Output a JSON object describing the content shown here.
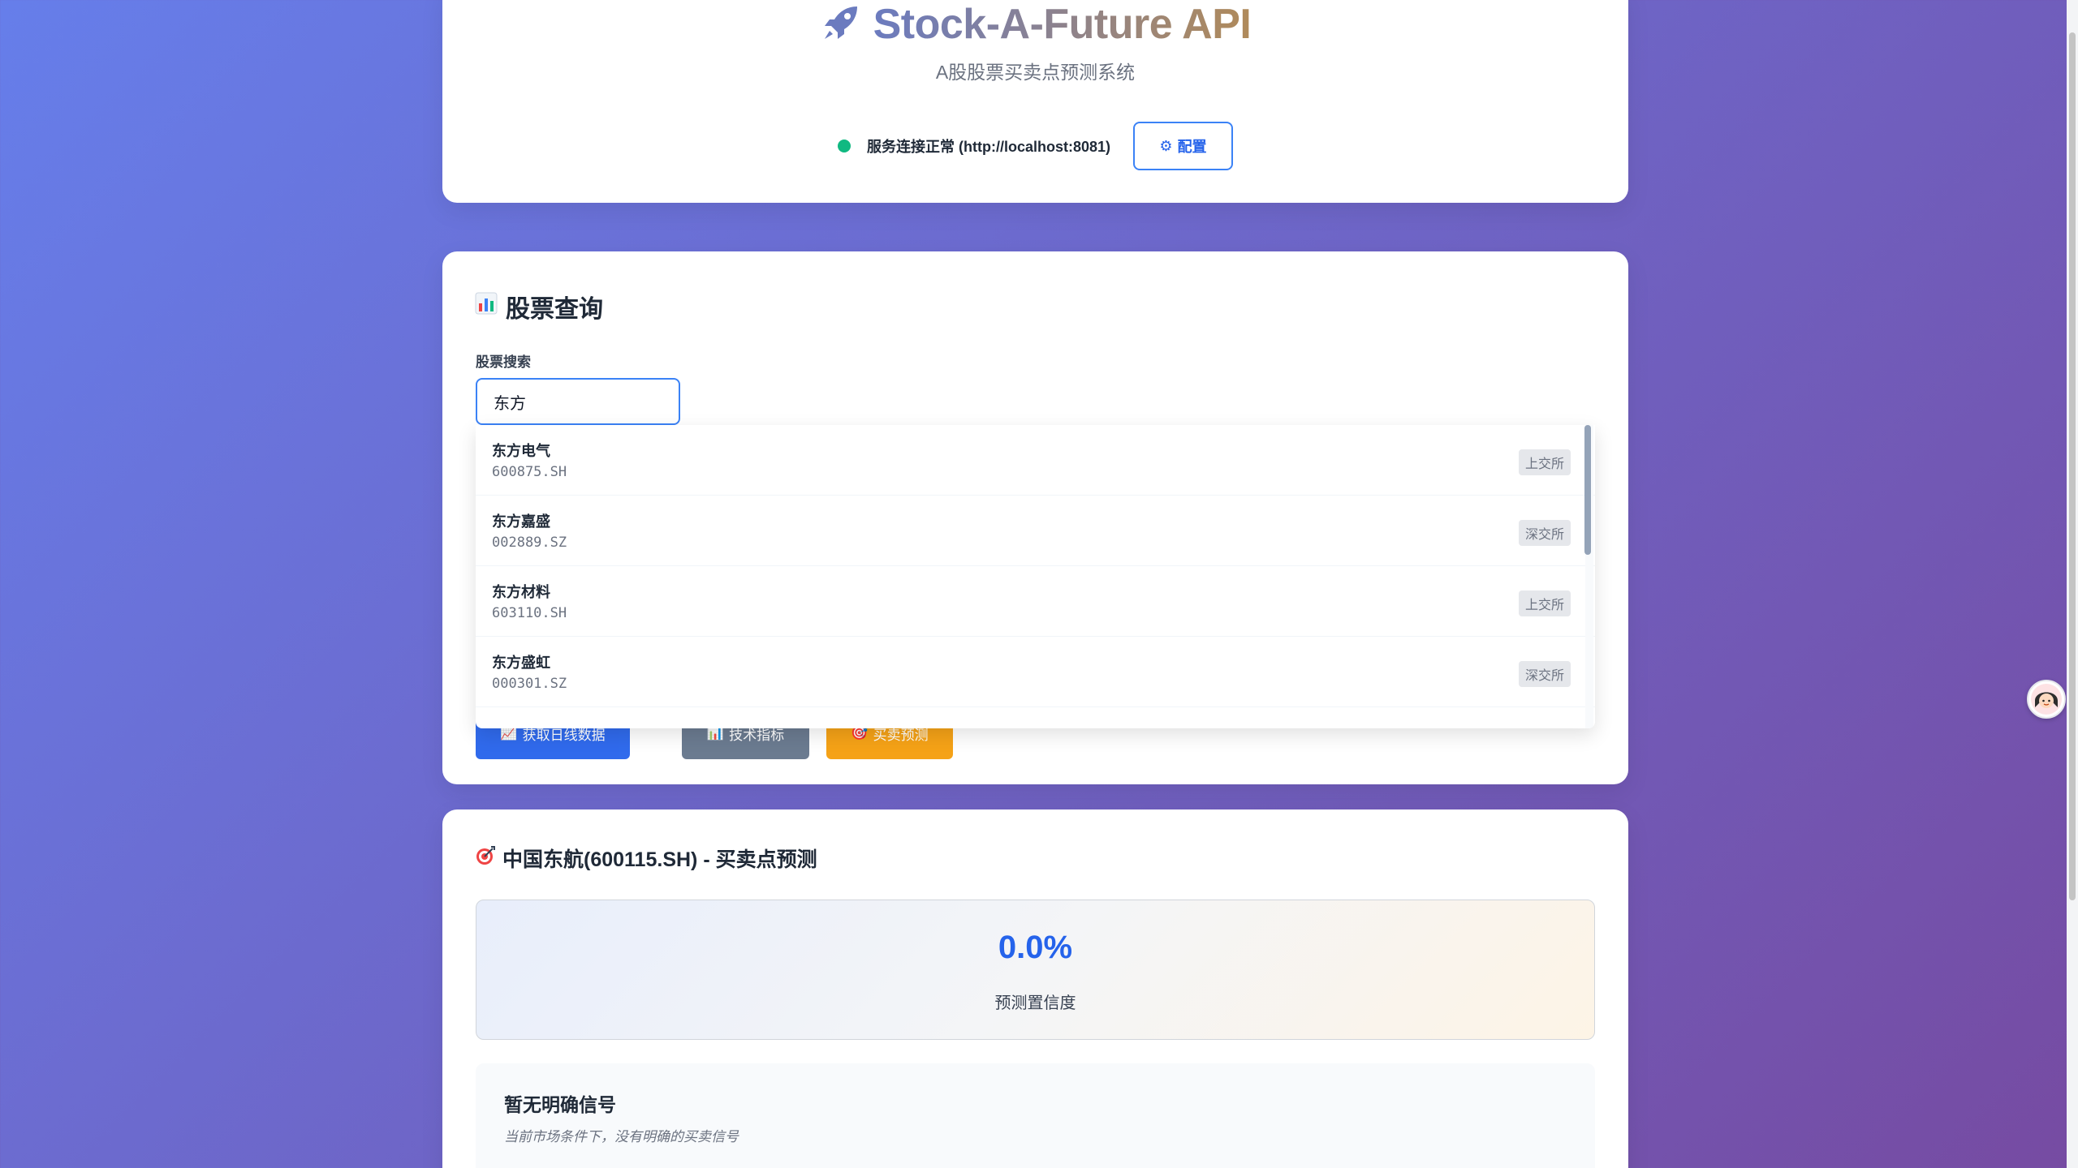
{
  "header": {
    "title": "Stock-A-Future API",
    "subtitle": "A股股票买卖点预测系统",
    "status_text": "服务连接正常 (http://localhost:8081)",
    "status_color": "#10b981",
    "config_label": "配置"
  },
  "query": {
    "section_title": "股票查询",
    "search_label": "股票搜索",
    "search_value": "东方",
    "results": [
      {
        "name": "东方电气",
        "code": "600875.SH",
        "exchange": "上交所"
      },
      {
        "name": "东方嘉盛",
        "code": "002889.SZ",
        "exchange": "深交所"
      },
      {
        "name": "东方材料",
        "code": "603110.SH",
        "exchange": "上交所"
      },
      {
        "name": "东方盛虹",
        "code": "000301.SZ",
        "exchange": "深交所"
      }
    ],
    "buttons": {
      "daily": "获取日线数据",
      "indicators": "技术指标",
      "predict": "买卖预测"
    }
  },
  "prediction": {
    "title": "中国东航(600115.SH) - 买卖点预测",
    "confidence_value": "0.0%",
    "confidence_label": "预测置信度",
    "signal_title": "暂无明确信号",
    "signal_desc": "当前市场条件下，没有明确的买卖信号"
  },
  "colors": {
    "accent": "#2563eb",
    "gray_button": "#64748b",
    "orange_button": "#f59e0b"
  }
}
